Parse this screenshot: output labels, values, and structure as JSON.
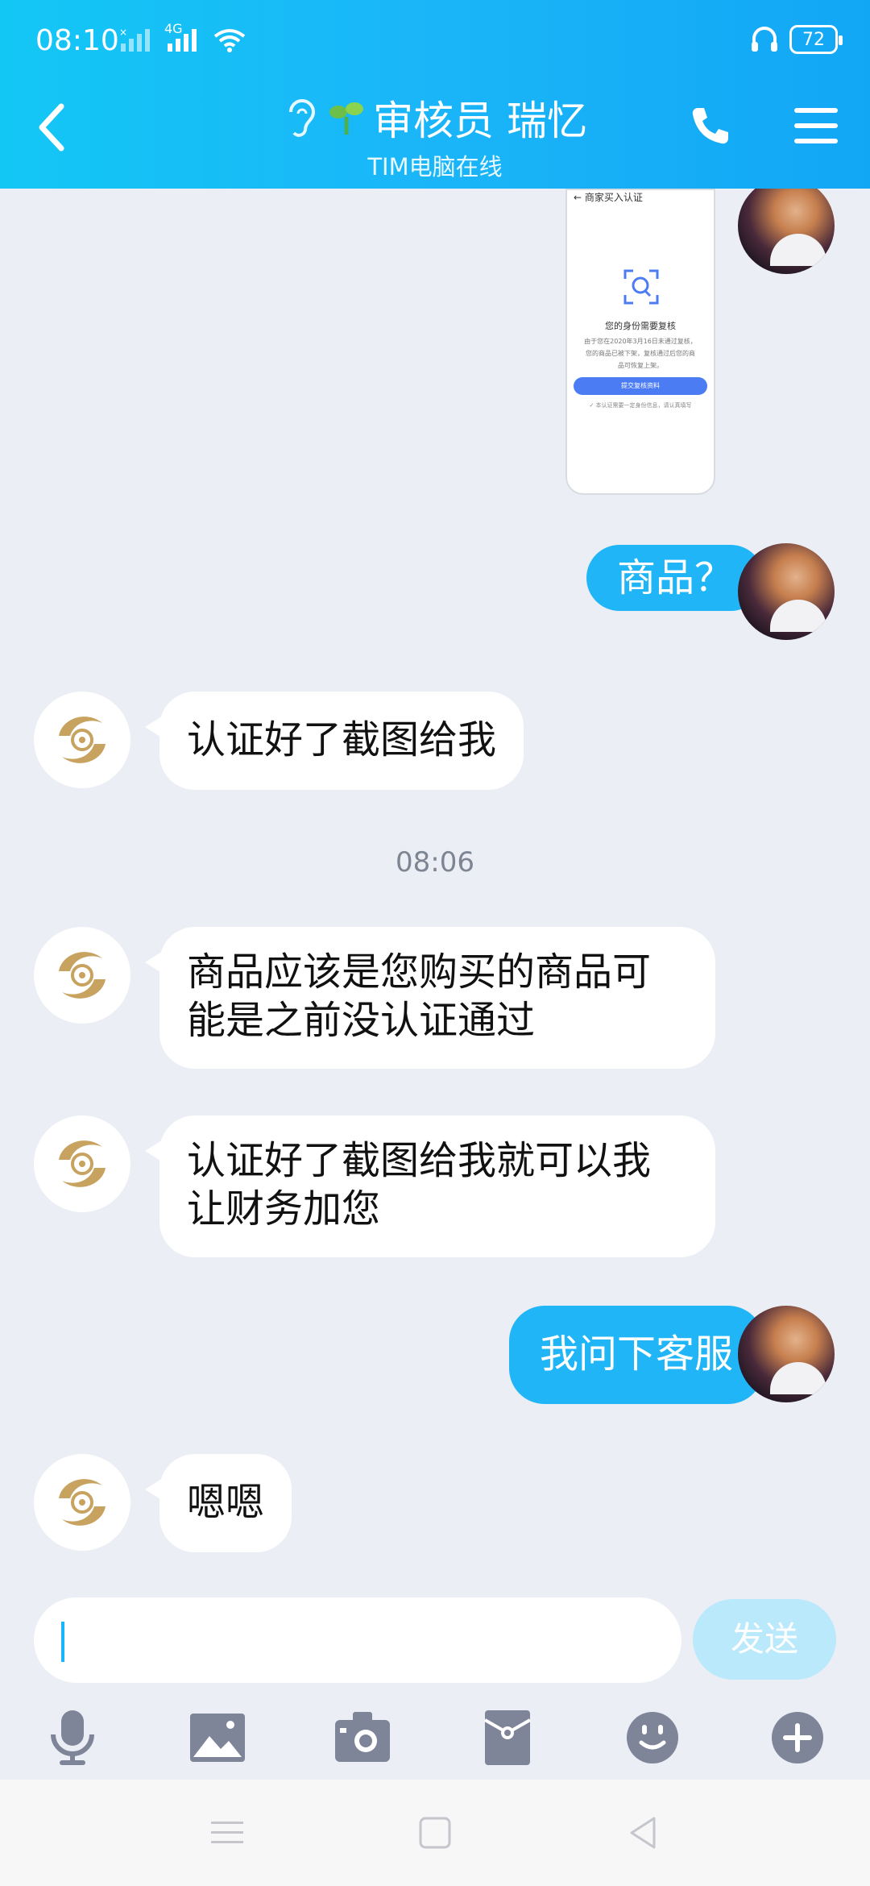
{
  "status_bar": {
    "time": "08:10",
    "network": "4G",
    "battery": "72"
  },
  "header": {
    "title": "审核员 瑞忆",
    "subtitle": "TIM电脑在线"
  },
  "shared_screenshot": {
    "header_text": "← 商家买入认证",
    "title": "您的身份需要复核",
    "description": "由于您在2020年3月16日未通过复核，您的商品已被下架，复核通过后您的商品可恢复上架。",
    "button_label": "提交复核资料",
    "footer_text": "✓ 本认证需要一定身份信息，请认真填写"
  },
  "messages": [
    {
      "id": "m1",
      "from": "me",
      "text": "商品？"
    },
    {
      "id": "m2",
      "from": "other",
      "text": "认证好了截图给我"
    },
    {
      "id": "m3",
      "from": "other",
      "text": "商品应该是您购买的商品可能是之前没认证通过"
    },
    {
      "id": "m4",
      "from": "other",
      "text": "认证好了截图给我就可以我让财务加您"
    },
    {
      "id": "m5",
      "from": "me",
      "text": "我问下客服"
    },
    {
      "id": "m6",
      "from": "other",
      "text": "嗯嗯"
    }
  ],
  "timestamp": "08:06",
  "input": {
    "placeholder": "",
    "send_label": "发送"
  },
  "toolbar": [
    "microphone-icon",
    "image-icon",
    "camera-icon",
    "red-packet-icon",
    "emoji-icon",
    "plus-icon"
  ],
  "colors": {
    "accent": "#1ab5f8",
    "bubble_out": "#1fb5f7",
    "bubble_in": "#ffffff",
    "background": "#eceef5"
  }
}
